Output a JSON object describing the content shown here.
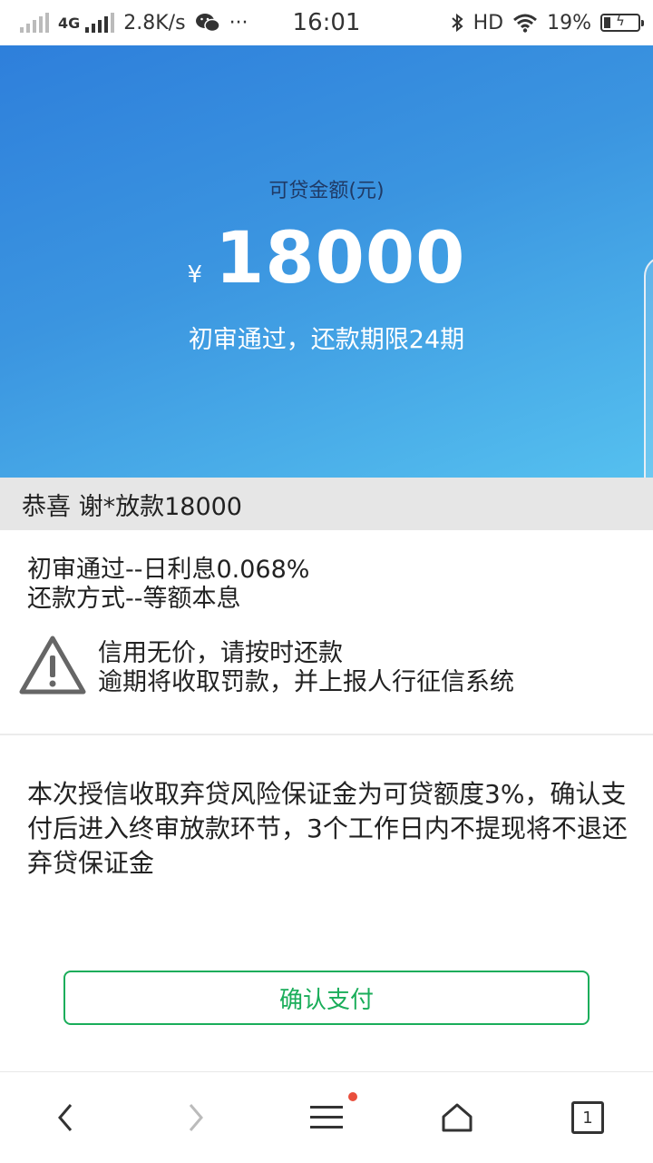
{
  "status_bar": {
    "network": "4G",
    "speed": "2.8K/s",
    "more": "···",
    "time": "16:01",
    "hd": "HD",
    "battery_percent": "19%",
    "battery_level": 0.19
  },
  "hero": {
    "label": "可贷金额(元)",
    "currency": "¥",
    "amount": "18000",
    "subtitle": "初审通过，还款期限24期"
  },
  "ticker": {
    "text": "恭喜 谢*放款18000"
  },
  "info": {
    "line1": "初审通过--日利息0.068%",
    "line2": "还款方式--等额本息"
  },
  "warning": {
    "icon": "warning-triangle-icon",
    "line1": "信用无价，请按时还款",
    "line2": "逾期将收取罚款，并上报人行征信系统"
  },
  "notice": {
    "text": "本次授信收取弃贷风险保证金为可贷额度3%，确认支付后进入终审放款环节，3个工作日内不提现将不退还弃贷保证金"
  },
  "confirm_button": {
    "label": "确认支付",
    "color": "#1aad5a"
  },
  "bottom_nav": {
    "tab_count": "1"
  }
}
